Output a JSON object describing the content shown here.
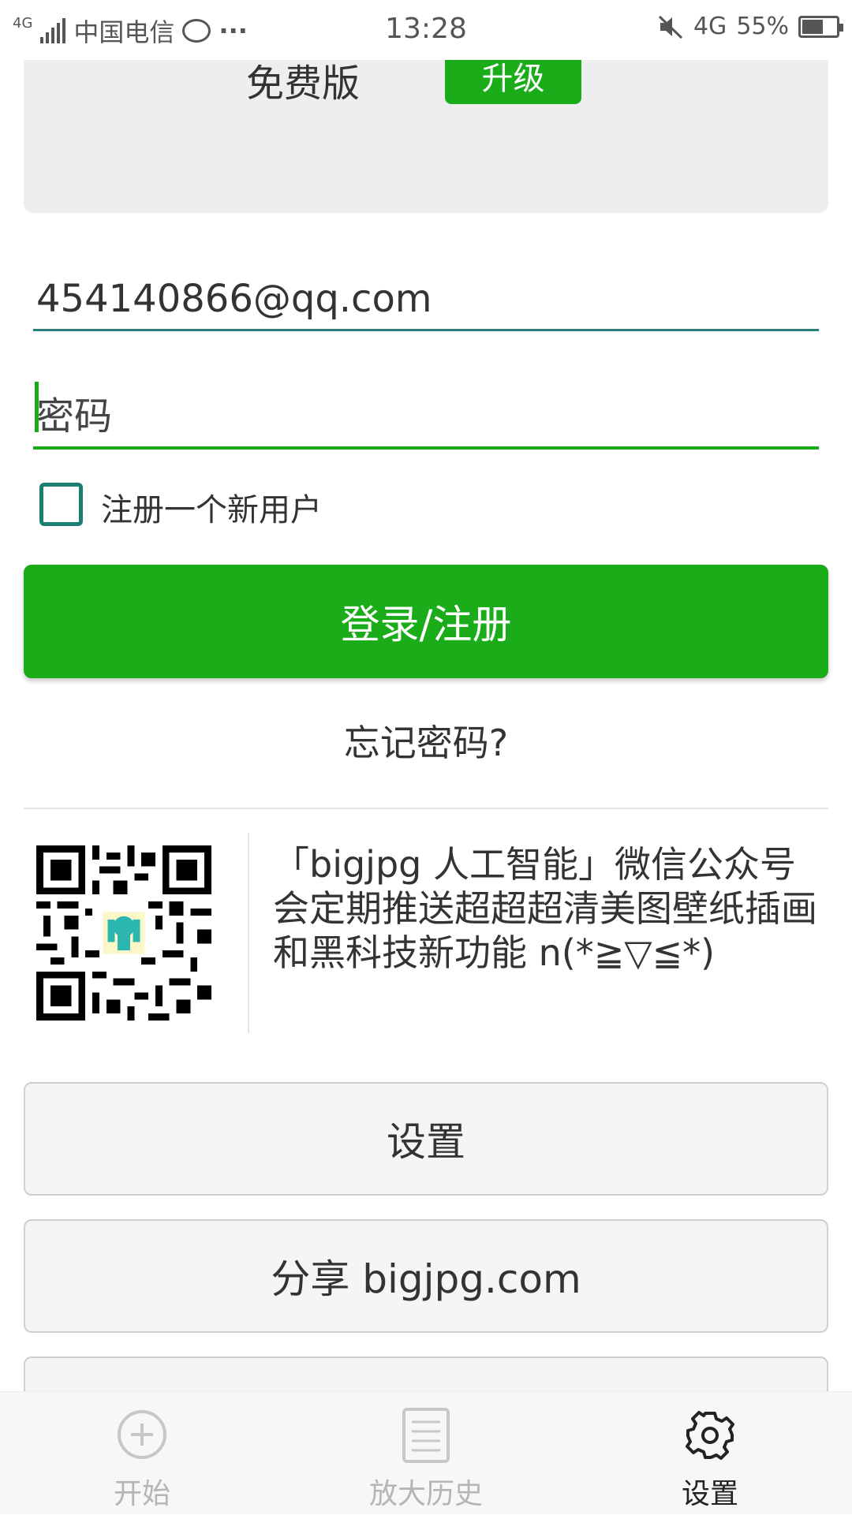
{
  "status_bar": {
    "network_left": "4G",
    "carrier": "中国电信",
    "dots": "···",
    "time": "13:28",
    "network_right": "4G",
    "battery_percent": "55%"
  },
  "upgrade": {
    "plan_label": "免费版",
    "upgrade_button": "升级"
  },
  "login_form": {
    "email_value": "454140866@qq.com",
    "password_placeholder": "密码",
    "register_checkbox_label": "注册一个新用户",
    "register_checked": false,
    "submit_button": "登录/注册",
    "forgot_password": "忘记密码?"
  },
  "wechat_promo": {
    "text": "「bigjpg 人工智能」微信公众号会定期推送超超超清美图壁纸插画和黑科技新功能 n(*≧▽≦*)"
  },
  "options": {
    "settings_button": "设置",
    "share_button": "分享 bigjpg.com"
  },
  "bottom_nav": {
    "items": [
      {
        "label": "开始",
        "icon": "plus-circle-icon",
        "active": false
      },
      {
        "label": "放大历史",
        "icon": "list-document-icon",
        "active": false
      },
      {
        "label": "设置",
        "icon": "gear-icon",
        "active": true
      }
    ]
  },
  "colors": {
    "accent_green": "#1aad19",
    "teal": "#1a7f72"
  }
}
